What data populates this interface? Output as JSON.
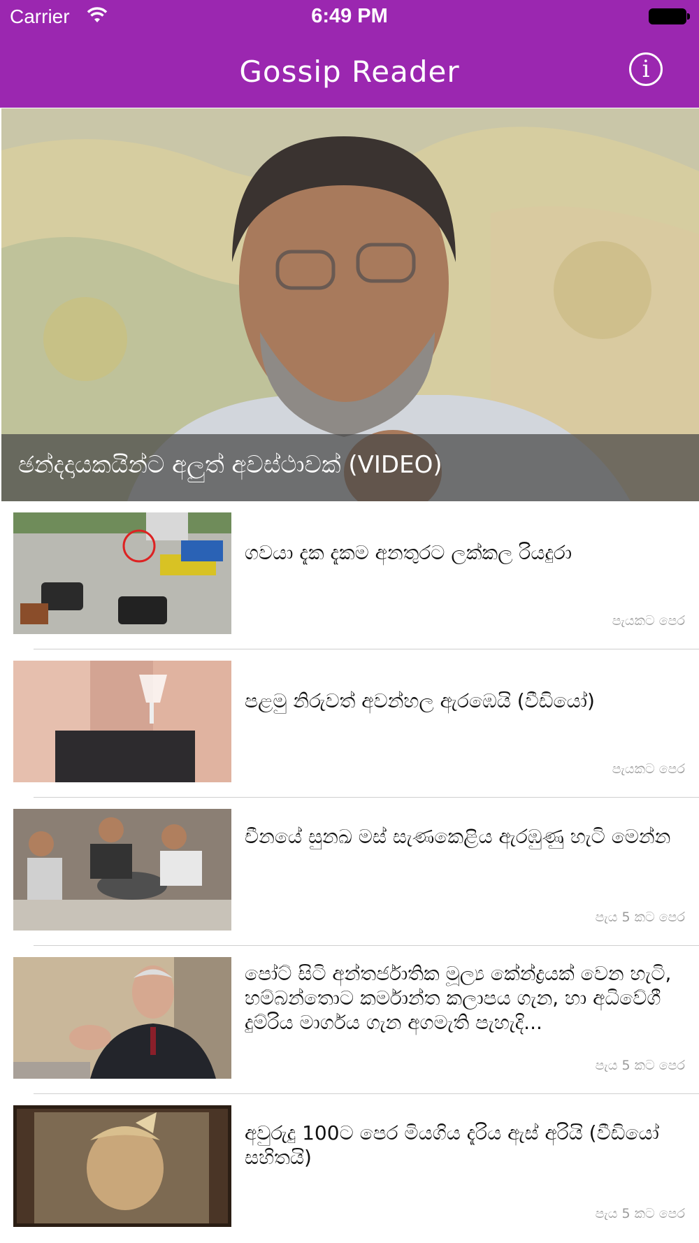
{
  "status_bar": {
    "carrier": "Carrier",
    "time": "6:49 PM"
  },
  "nav": {
    "title": "Gossip Reader",
    "info_icon": "info-icon"
  },
  "featured": {
    "title": "ඡන්දදායකයින්ට අලුත් අවස්ථාවක් (VIDEO)"
  },
  "articles": [
    {
      "title": "ගවයා දැක දැකම අනතුරට ලක්කල රියදුරා",
      "time": "පැයකට පෙර"
    },
    {
      "title": "පළමු නිරුවත් අවන්හල ඇරඹෙයි (වීඩියෝ)",
      "time": "පැයකට පෙර"
    },
    {
      "title": "චීනයේ සුනඛ මස් සැණකෙළිය ඇරඹුණු හැටි මෙන්න",
      "time": "පැය 5 කට පෙර"
    },
    {
      "title": "පෝට් සිටි අන්තර්ජාතික මූල්‍ය කේන්ද්‍රයක් වෙන හැටි, හම්බන්තොට කර්මාන්ත කලාපය ගැන, හා අධිවේගී දුම්රිය මාර්ගය ගැන අගමැති පැහැදි...",
      "time": "පැය 5 කට පෙර"
    },
    {
      "title": "අවුරුදු 100ට පෙර මියගිය දැරිය ඇස් අරියි (වීඩියෝ සහිතයි)",
      "time": "පැය 5 කට පෙර"
    }
  ],
  "colors": {
    "nav_bar": "#9b27b0",
    "caption_overlay": "#464646",
    "time_text": "#9a9a9a"
  }
}
